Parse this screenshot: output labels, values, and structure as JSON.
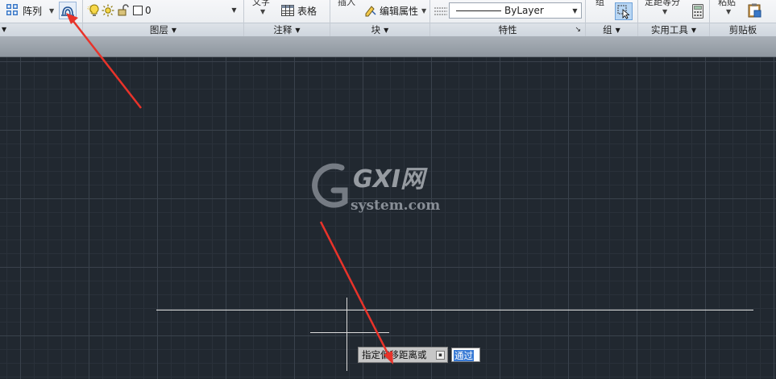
{
  "ribbon": {
    "modify_panel": {
      "title_fragment": "",
      "array_label": "阵列"
    },
    "layers_panel": {
      "title": "图层",
      "current_layer": "0"
    },
    "annotation_panel": {
      "title": "注释",
      "text_label": "文字",
      "table_label": "表格"
    },
    "block_panel": {
      "title": "块",
      "insert_label": "插入",
      "edit_attributes_label": "编辑属性"
    },
    "properties_panel": {
      "title": "特性",
      "linetype_value": "ByLayer"
    },
    "group_panel": {
      "title": "组",
      "group_label": "组"
    },
    "utilities_panel": {
      "title": "实用工具",
      "measure_label": "定距等分"
    },
    "clipboard_panel": {
      "title": "剪贴板",
      "paste_label": "粘贴"
    }
  },
  "canvas": {
    "watermark": {
      "brand": "GXI网",
      "domain": "system.com"
    }
  },
  "command_prompt": {
    "prompt_text": "指定偏移距离或",
    "input_value": "通过"
  },
  "colors": {
    "canvas_bg": "#212830",
    "ribbon_bg": "#eef0f3",
    "annotation_arrow": "#e8332a",
    "selection_blue": "#3a7bd5"
  }
}
